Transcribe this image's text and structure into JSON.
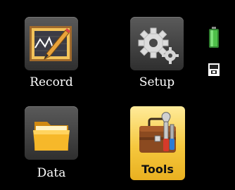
{
  "menu": {
    "record_label": "Record",
    "setup_label": "Setup",
    "data_label": "Data",
    "tools_label": "Tools",
    "selected": "Tools"
  },
  "status": {
    "battery_icon": "battery-full-icon",
    "storage_icon": "storage-card-icon",
    "battery_color": "#3fb63f"
  },
  "colors": {
    "highlight": "#f5c83e",
    "tile": "#444444",
    "background": "#000000"
  }
}
